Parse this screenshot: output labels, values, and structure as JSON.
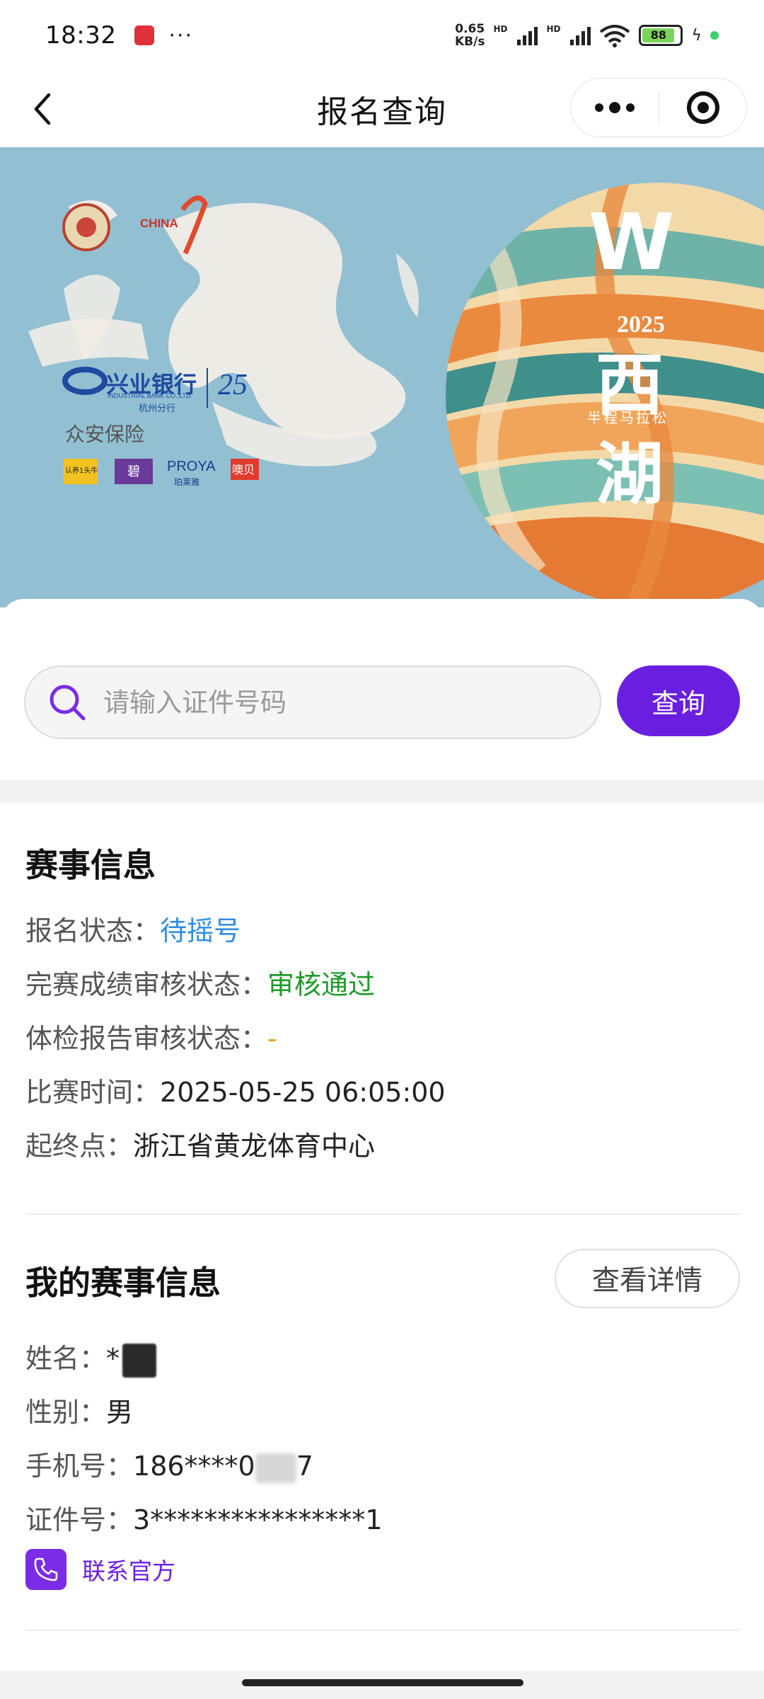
{
  "status_bar": {
    "time": "18:32",
    "app_badge": "小红书",
    "more": "···",
    "net_speed_top": "0.65",
    "net_speed_bottom": "KB/s",
    "hd1": "HD",
    "hd2": "HD",
    "battery": "88",
    "icons": [
      "app-notification-icon",
      "signal-icon",
      "wifi-icon",
      "battery-icon",
      "charging-icon"
    ]
  },
  "nav": {
    "title": "报名查询",
    "icons": [
      "back-arrow-icon",
      "more-dots-icon",
      "close-target-icon"
    ]
  },
  "banner": {
    "logo_text_china": "CHINA",
    "sponsor_bank": "兴业银行",
    "sponsor_bank_en": "INDUSTRIAL BANK CO.,LTD.",
    "sponsor_bank_branch": "杭州分行",
    "sponsor_anniv": "25",
    "sponsor_insurance": "众安保险",
    "sponsor_proya": "PROYA",
    "sponsor_proya_cn": "珀莱雅",
    "sponsor_small_1": "认养1头牛",
    "sponsor_small_2": "碧",
    "sponsor_small_3": "噢贝",
    "year": "2025",
    "xi": "西",
    "hu": "湖",
    "half_marathon": "半程马拉松",
    "w_mark": "W"
  },
  "search": {
    "placeholder": "请输入证件号码",
    "value": "",
    "button": "查询"
  },
  "event_info": {
    "title": "赛事信息",
    "rows": [
      {
        "label": "报名状态：",
        "value": "待摇号"
      },
      {
        "label": "完赛成绩审核状态：",
        "value": "审核通过"
      },
      {
        "label": "体检报告审核状态：",
        "value": "-"
      },
      {
        "label": "比赛时间：",
        "value": "2025-05-25 06:05:00"
      },
      {
        "label": "起终点：",
        "value": "浙江省黄龙体育中心"
      }
    ],
    "colors": {
      "pending": "#2f8de4",
      "passed": "#1f9a2a",
      "dash": "#e6a020"
    }
  },
  "my_info": {
    "title": "我的赛事信息",
    "detail_button": "查看详情",
    "rows": [
      {
        "label": "姓名：",
        "value": "*"
      },
      {
        "label": "性别：",
        "value": "男"
      },
      {
        "label": "手机号：",
        "value_prefix": "186****0",
        "value_suffix": "7"
      },
      {
        "label": "证件号：",
        "value": "3****************1"
      }
    ],
    "contact": "联系官方"
  },
  "accent_color": "#6a1fe0"
}
